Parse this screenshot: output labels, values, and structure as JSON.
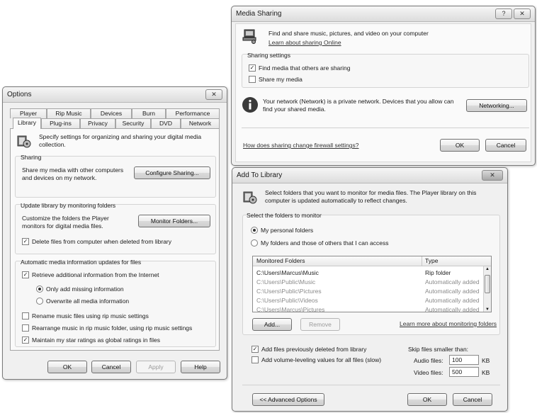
{
  "options": {
    "title": "Options",
    "close_glyph": "✕",
    "tabs_row1": [
      "Player",
      "Rip Music",
      "Devices",
      "Burn",
      "Performance"
    ],
    "tabs_row2": [
      "Library",
      "Plug-ins",
      "Privacy",
      "Security",
      "DVD",
      "Network"
    ],
    "intro": "Specify settings for organizing and sharing your digital media collection.",
    "sharing": {
      "label": "Sharing",
      "text": "Share my media with other computers and devices on my network.",
      "button": "Configure Sharing..."
    },
    "monitor": {
      "label": "Update library by monitoring folders",
      "text": "Customize the folders the Player monitors for digital media files.",
      "button": "Monitor Folders...",
      "delete_checkbox": "Delete files from computer when deleted from library"
    },
    "auto": {
      "label": "Automatic media information updates for files",
      "retrieve": "Retrieve additional information from the Internet",
      "only_missing": "Only add missing information",
      "overwrite_all": "Overwrite all media information",
      "rename": "Rename music files using rip music settings",
      "rearrange": "Rearrange music in rip music folder, using rip music settings",
      "maintain": "Maintain my star ratings as global ratings in files"
    },
    "buttons": {
      "ok": "OK",
      "cancel": "Cancel",
      "apply": "Apply",
      "help": "Help"
    }
  },
  "media_sharing": {
    "title": "Media Sharing",
    "help_glyph": "?",
    "close_glyph": "✕",
    "intro": "Find and share music, pictures, and video on your computer",
    "learn_link": "Learn about sharing Online",
    "settings_label": "Sharing settings",
    "find_media": "Find media that others are sharing",
    "share_media": "Share my media",
    "network_text": "Your network (Network) is a private network. Devices that you allow can find your shared media.",
    "networking_button": "Networking...",
    "firewall_link": "How does sharing change firewall settings?",
    "ok": "OK",
    "cancel": "Cancel"
  },
  "add_to_library": {
    "title": "Add To Library",
    "close_glyph": "✕",
    "intro": "Select folders that you want to monitor for media files. The Player library on this computer is updated automatically to reflect changes.",
    "select_label": "Select the folders to monitor",
    "personal": "My personal folders",
    "others": "My folders and those of others that I can access",
    "col_folders": "Monitored Folders",
    "col_type": "Type",
    "rows": [
      {
        "folder": "C:\\Users\\Marcus\\Music",
        "type": "Rip folder"
      },
      {
        "folder": "C:\\Users\\Public\\Music",
        "type": "Automatically added"
      },
      {
        "folder": "C:\\Users\\Public\\Pictures",
        "type": "Automatically added"
      },
      {
        "folder": "C:\\Users\\Public\\Videos",
        "type": "Automatically added"
      },
      {
        "folder": "C:\\Users\\Marcus\\Pictures",
        "type": "Automatically added"
      }
    ],
    "add_button": "Add...",
    "remove_button": "Remove",
    "learn_link": "Learn more about monitoring folders",
    "add_deleted": "Add files previously deleted from library",
    "add_volume": "Add volume-leveling values for all files (slow)",
    "skip_label": "Skip files smaller than:",
    "audio_label": "Audio files:",
    "audio_value": "100",
    "video_label": "Video files:",
    "video_value": "500",
    "kb": "KB",
    "advanced_button": "<< Advanced Options",
    "ok": "OK",
    "cancel": "Cancel"
  }
}
